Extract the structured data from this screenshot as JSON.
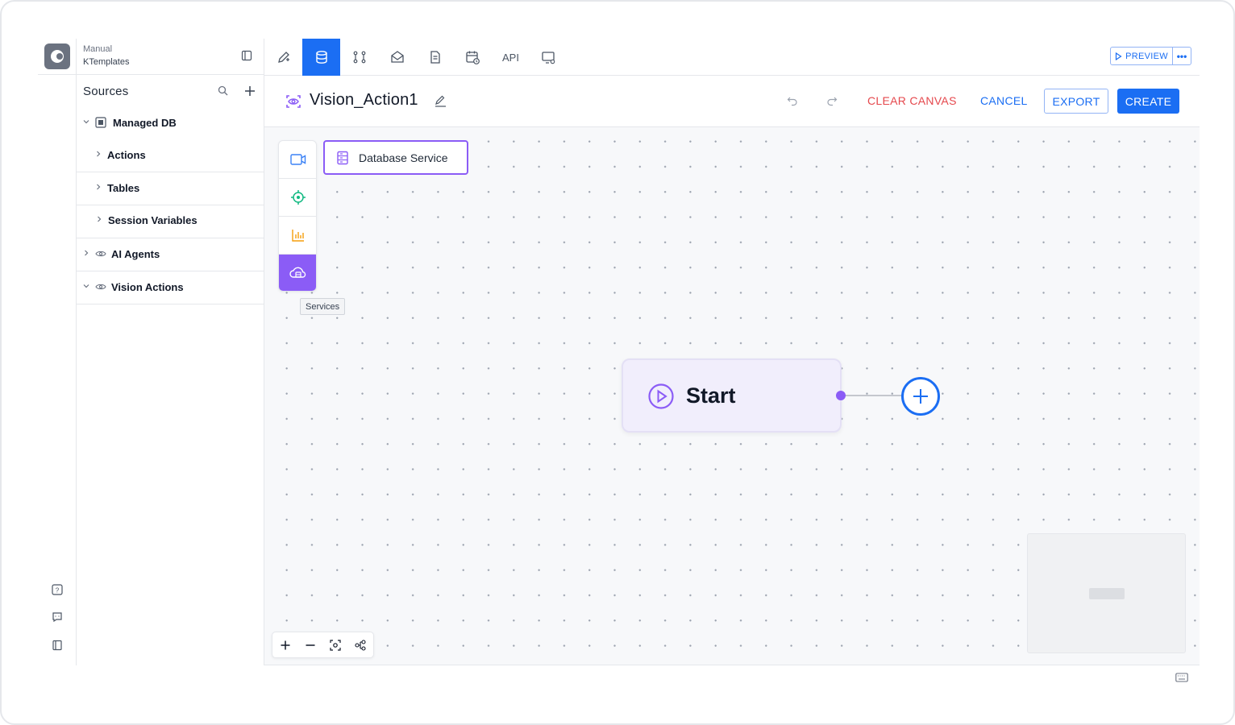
{
  "workspace": {
    "label": "Manual",
    "name": "KTemplates"
  },
  "sidebar": {
    "sources_label": "Sources",
    "tree": [
      {
        "label": "Managed DB",
        "expanded": true
      },
      {
        "label": "Actions",
        "expanded": false
      },
      {
        "label": "Tables",
        "expanded": false
      },
      {
        "label": "Session Variables",
        "expanded": false
      },
      {
        "label": "AI Agents",
        "expanded": false
      },
      {
        "label": "Vision Actions",
        "expanded": true
      }
    ]
  },
  "tabs": {
    "active_index": 1,
    "api_label": "API",
    "items": [
      "edit-icon",
      "database-icon",
      "workflow-icon",
      "mail-icon",
      "document-icon",
      "schedule-icon",
      "api",
      "screen-settings-icon"
    ]
  },
  "toolbar": {
    "preview_label": "PREVIEW",
    "more_label": "•••"
  },
  "title_bar": {
    "title": "Vision_Action1",
    "clear_canvas_label": "CLEAR CANVAS",
    "cancel_label": "CANCEL",
    "export_label": "EXPORT",
    "create_label": "CREATE"
  },
  "canvas": {
    "palette": [
      "video-icon",
      "target-icon",
      "chart-icon",
      "services-icon"
    ],
    "tooltip": "Services",
    "database_service_label": "Database Service",
    "start_label": "Start"
  },
  "colors": {
    "primary": "#1b6ef3",
    "accent_purple": "#8b5cf6",
    "danger": "#e5484d",
    "start_bg": "#f1eefc"
  }
}
